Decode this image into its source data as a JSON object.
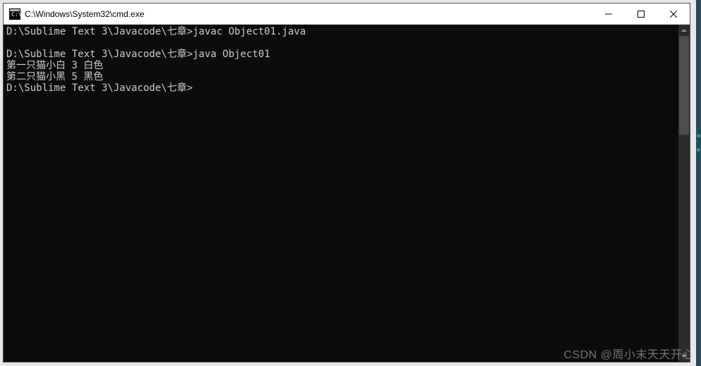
{
  "titlebar": {
    "title": "C:\\Windows\\System32\\cmd.exe"
  },
  "terminal": {
    "lines": [
      "D:\\Sublime Text 3\\Javacode\\七章>javac Object01.java",
      "",
      "D:\\Sublime Text 3\\Javacode\\七章>java Object01",
      "第一只猫小白 3 白色",
      "第二只猫小黑 5 黑色",
      "D:\\Sublime Text 3\\Javacode\\七章>"
    ]
  },
  "watermark": "CSDN @周小末天天开心"
}
